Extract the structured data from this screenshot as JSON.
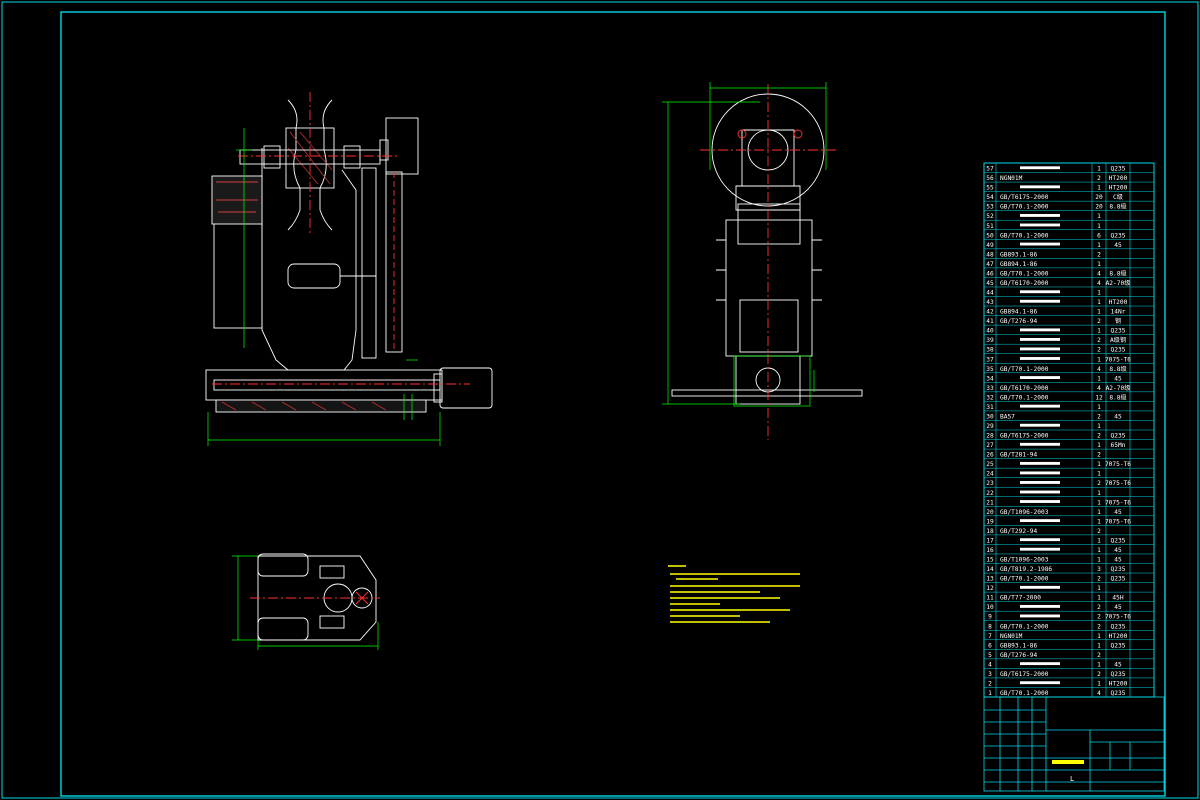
{
  "colors": {
    "background": "#000000",
    "frame": "#00d8e8",
    "part_outline": "#ffffff",
    "dimension": "#00ff00",
    "centerline": "#ff3030",
    "notes": "#ffff00",
    "table_text": "#ffffff"
  },
  "bom": {
    "rows": [
      {
        "no": "57",
        "code": "",
        "qty": "1",
        "mat": "Q235"
      },
      {
        "no": "56",
        "code": "NGN01M",
        "qty": "2",
        "mat": "HT200"
      },
      {
        "no": "55",
        "code": "",
        "qty": "1",
        "mat": "HT200"
      },
      {
        "no": "54",
        "code": "GB/T6175-2000",
        "qty": "20",
        "mat": "C级"
      },
      {
        "no": "53",
        "code": "GB/T70.1-2000",
        "qty": "20",
        "mat": "8.8级"
      },
      {
        "no": "52",
        "code": "",
        "qty": "1",
        "mat": ""
      },
      {
        "no": "51",
        "code": "",
        "qty": "1",
        "mat": ""
      },
      {
        "no": "50",
        "code": "GB/T70.1-2000",
        "qty": "6",
        "mat": "Q235"
      },
      {
        "no": "49",
        "code": "",
        "qty": "1",
        "mat": "45"
      },
      {
        "no": "48",
        "code": "GB893.1-86",
        "qty": "2",
        "mat": ""
      },
      {
        "no": "47",
        "code": "GB894.1-86",
        "qty": "1",
        "mat": ""
      },
      {
        "no": "46",
        "code": "GB/T70.1-2000",
        "qty": "4",
        "mat": "8.8级"
      },
      {
        "no": "45",
        "code": "GB/T6170-2000",
        "qty": "4",
        "mat": "A2-70级"
      },
      {
        "no": "44",
        "code": "",
        "qty": "1",
        "mat": ""
      },
      {
        "no": "43",
        "code": "",
        "qty": "1",
        "mat": "HT200"
      },
      {
        "no": "42",
        "code": "GB894.1-86",
        "qty": "1",
        "mat": "14Nr"
      },
      {
        "no": "41",
        "code": "GB/T276-94",
        "qty": "2",
        "mat": "钢"
      },
      {
        "no": "40",
        "code": "",
        "qty": "1",
        "mat": "Q235"
      },
      {
        "no": "39",
        "code": "",
        "qty": "2",
        "mat": "A级钢"
      },
      {
        "no": "38",
        "code": "",
        "qty": "2",
        "mat": "Q235"
      },
      {
        "no": "37",
        "code": "",
        "qty": "1",
        "mat": "7075-T6"
      },
      {
        "no": "35",
        "code": "GB/T70.1-2000",
        "qty": "4",
        "mat": "8.8级"
      },
      {
        "no": "34",
        "code": "",
        "qty": "1",
        "mat": "45"
      },
      {
        "no": "33",
        "code": "GB/T6170-2000",
        "qty": "4",
        "mat": "A2-70级"
      },
      {
        "no": "32",
        "code": "GB/T70.1-2000",
        "qty": "12",
        "mat": "8.8级"
      },
      {
        "no": "31",
        "code": "",
        "qty": "1",
        "mat": ""
      },
      {
        "no": "30",
        "code": "BA57",
        "qty": "2",
        "mat": "45"
      },
      {
        "no": "29",
        "code": "",
        "qty": "1",
        "mat": ""
      },
      {
        "no": "28",
        "code": "GB/T6175-2000",
        "qty": "2",
        "mat": "Q235"
      },
      {
        "no": "27",
        "code": "",
        "qty": "1",
        "mat": "65Mn"
      },
      {
        "no": "26",
        "code": "GB/T281-94",
        "qty": "2",
        "mat": ""
      },
      {
        "no": "25",
        "code": "",
        "qty": "1",
        "mat": "7075-T6"
      },
      {
        "no": "24",
        "code": "",
        "qty": "1",
        "mat": ""
      },
      {
        "no": "23",
        "code": "",
        "qty": "2",
        "mat": "7075-T6"
      },
      {
        "no": "22",
        "code": "",
        "qty": "1",
        "mat": ""
      },
      {
        "no": "21",
        "code": "",
        "qty": "1",
        "mat": "7075-T6"
      },
      {
        "no": "20",
        "code": "GB/T1096-2003",
        "qty": "1",
        "mat": "45"
      },
      {
        "no": "19",
        "code": "",
        "qty": "1",
        "mat": "7075-T6"
      },
      {
        "no": "18",
        "code": "GB/T292-94",
        "qty": "2",
        "mat": ""
      },
      {
        "no": "17",
        "code": "",
        "qty": "1",
        "mat": "Q235"
      },
      {
        "no": "16",
        "code": "",
        "qty": "1",
        "mat": "45"
      },
      {
        "no": "15",
        "code": "GB/T1096-2003",
        "qty": "1",
        "mat": "45"
      },
      {
        "no": "14",
        "code": "GB/T819.2-1986",
        "qty": "3",
        "mat": "Q235"
      },
      {
        "no": "13",
        "code": "GB/T70.1-2000",
        "qty": "2",
        "mat": "Q235"
      },
      {
        "no": "12",
        "code": "",
        "qty": "1",
        "mat": ""
      },
      {
        "no": "11",
        "code": "GB/T77-2000",
        "qty": "1",
        "mat": "45H"
      },
      {
        "no": "10",
        "code": "",
        "qty": "2",
        "mat": "45"
      },
      {
        "no": "9",
        "code": "",
        "qty": "2",
        "mat": "7075-T6"
      },
      {
        "no": "8",
        "code": "GB/T70.1-2000",
        "qty": "2",
        "mat": "Q235"
      },
      {
        "no": "7",
        "code": "NGN01M",
        "qty": "1",
        "mat": "HT200"
      },
      {
        "no": "6",
        "code": "GB893.1-86",
        "qty": "1",
        "mat": "Q235"
      },
      {
        "no": "5",
        "code": "GB/T276-94",
        "qty": "2",
        "mat": ""
      },
      {
        "no": "4",
        "code": "",
        "qty": "1",
        "mat": "45"
      },
      {
        "no": "3",
        "code": "GB/T6175-2000",
        "qty": "2",
        "mat": "Q235"
      },
      {
        "no": "2",
        "code": "",
        "qty": "1",
        "mat": "HT200"
      },
      {
        "no": "1",
        "code": "GB/T70.1-2000",
        "qty": "4",
        "mat": "Q235"
      }
    ]
  },
  "title_block": {
    "sheet_mark": "L"
  }
}
